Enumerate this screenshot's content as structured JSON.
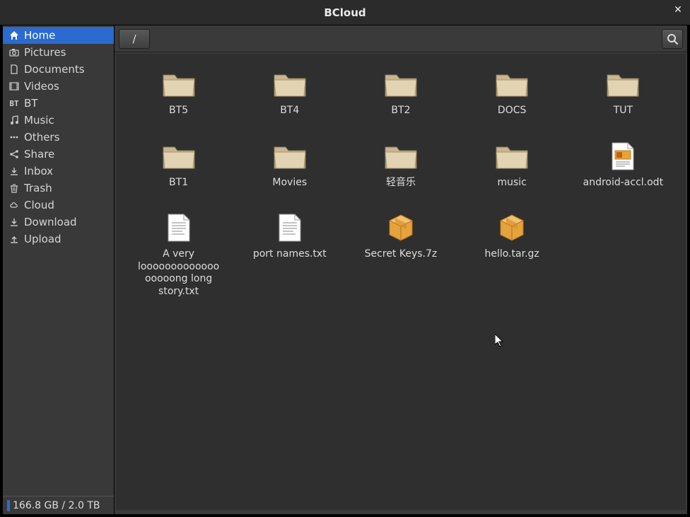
{
  "window": {
    "title": "BCloud"
  },
  "sidebar": {
    "items": [
      {
        "label": "Home",
        "icon": "home",
        "active": true
      },
      {
        "label": "Pictures",
        "icon": "camera",
        "active": false
      },
      {
        "label": "Documents",
        "icon": "doc",
        "active": false
      },
      {
        "label": "Videos",
        "icon": "film",
        "active": false
      },
      {
        "label": "BT",
        "icon": "bt",
        "active": false
      },
      {
        "label": "Music",
        "icon": "music",
        "active": false
      },
      {
        "label": "Others",
        "icon": "dots",
        "active": false
      },
      {
        "label": "Share",
        "icon": "share",
        "active": false
      },
      {
        "label": "Inbox",
        "icon": "download",
        "active": false
      },
      {
        "label": "Trash",
        "icon": "trash",
        "active": false
      },
      {
        "label": "Cloud",
        "icon": "cloud",
        "active": false
      },
      {
        "label": "Download",
        "icon": "download",
        "active": false
      },
      {
        "label": "Upload",
        "icon": "upload",
        "active": false
      }
    ],
    "status": "166.8 GB / 2.0 TB"
  },
  "toolbar": {
    "path": "/"
  },
  "files": [
    {
      "name": "BT5",
      "type": "folder"
    },
    {
      "name": "BT4",
      "type": "folder"
    },
    {
      "name": "BT2",
      "type": "folder"
    },
    {
      "name": "DOCS",
      "type": "folder"
    },
    {
      "name": "TUT",
      "type": "folder"
    },
    {
      "name": "BT1",
      "type": "folder"
    },
    {
      "name": "Movies",
      "type": "folder"
    },
    {
      "name": "轻音乐",
      "type": "folder"
    },
    {
      "name": "music",
      "type": "folder"
    },
    {
      "name": "android-accl.odt",
      "type": "odt"
    },
    {
      "name": "A very loooooooooooooooooong long story.txt",
      "type": "txt"
    },
    {
      "name": "port names.txt",
      "type": "txt"
    },
    {
      "name": "Secret Keys.7z",
      "type": "archive"
    },
    {
      "name": "hello.tar.gz",
      "type": "archive"
    }
  ],
  "colors": {
    "accent": "#2b6bd1",
    "bg": "#3a3a3a",
    "pane": "#2f2f2f"
  }
}
